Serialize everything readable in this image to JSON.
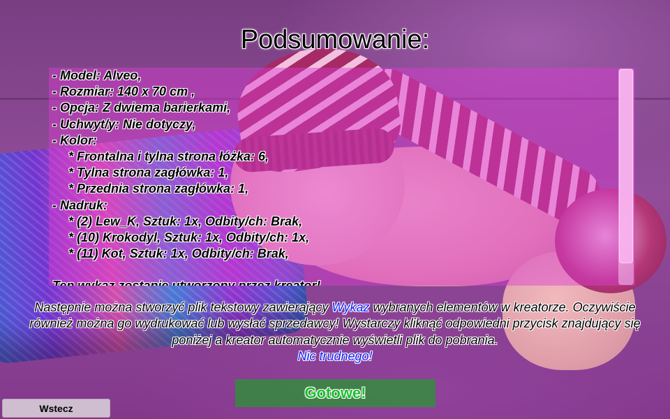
{
  "title": "Podsumowanie:",
  "summary": {
    "lines": [
      "- Model: Alveo,",
      "- Rozmiar: 140 x 70 cm ,",
      "- Opcja: Z dwiema barierkami,",
      "- Uchwyt/y: Nie dotyczy,",
      "- Kolor:",
      "* Frontalna i tylna strona łóżka: 6,",
      "* Tylna strona zagłówka: 1,",
      "* Przednia strona zagłówka: 1,",
      "- Nadruk:",
      "* (2) Lew_K, Sztuk: 1x, Odbity/ch: Brak,",
      "* (10) Krokodyl, Sztuk: 1x, Odbity/ch: 1x,",
      "* (11) Kot, Sztuk: 1x, Odbity/ch: Brak,",
      "Ten wykaz zostanie utworzony przez kreator!"
    ]
  },
  "info": {
    "part1": "Następnie można stworzyć plik tekstowy zawierający ",
    "link": "Wykaz",
    "part2": " wybranych elementów w kreatorze. Oczywiście również można go wydrukować lub wysłać sprzedawcy! Wystarczy kliknąć odpowiedni przycisk znajdujący się poniżej a kreator automatycznie wyświetli plik do pobrania.",
    "emphasis": "Nic trudnego!"
  },
  "buttons": {
    "done": "Gotowe!",
    "back": "Wstecz"
  },
  "colors": {
    "panel": "#dc3cd2",
    "link": "#1020ff",
    "done_bg": "#289632",
    "done_text": "#1fbf2f"
  }
}
